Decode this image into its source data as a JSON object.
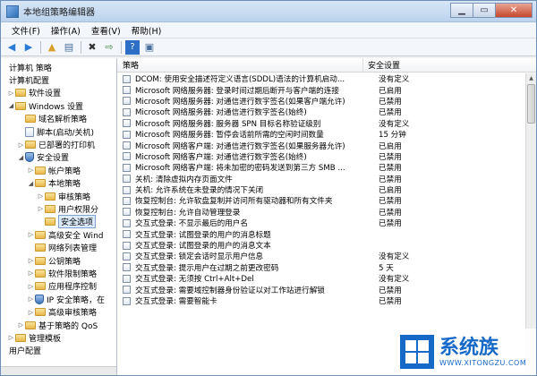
{
  "window": {
    "title": "本地组策略编辑器"
  },
  "menu": [
    "文件(F)",
    "操作(A)",
    "查看(V)",
    "帮助(H)"
  ],
  "tree": [
    {
      "indent": 0,
      "label": "计算机 策略",
      "icon": "none",
      "twisty": ""
    },
    {
      "indent": 0,
      "label": "计算机配置",
      "icon": "none",
      "twisty": ""
    },
    {
      "indent": 1,
      "label": "软件设置",
      "icon": "folder",
      "twisty": "▷"
    },
    {
      "indent": 1,
      "label": "Windows 设置",
      "icon": "folder",
      "twisty": "◢"
    },
    {
      "indent": 2,
      "label": "域名解析策略",
      "icon": "folder",
      "twisty": ""
    },
    {
      "indent": 2,
      "label": "脚本(启动/关机)",
      "icon": "doc",
      "twisty": ""
    },
    {
      "indent": 2,
      "label": "已部署的打印机",
      "icon": "folder",
      "twisty": "▷"
    },
    {
      "indent": 2,
      "label": "安全设置",
      "icon": "shield",
      "twisty": "◢"
    },
    {
      "indent": 3,
      "label": "帐户策略",
      "icon": "folder",
      "twisty": "▷"
    },
    {
      "indent": 3,
      "label": "本地策略",
      "icon": "folder",
      "twisty": "◢"
    },
    {
      "indent": 4,
      "label": "审核策略",
      "icon": "folder",
      "twisty": "▷"
    },
    {
      "indent": 4,
      "label": "用户权限分",
      "icon": "folder",
      "twisty": "▷"
    },
    {
      "indent": 4,
      "label": "安全选项",
      "icon": "folder",
      "twisty": "",
      "selected": true
    },
    {
      "indent": 3,
      "label": "高级安全 Wind",
      "icon": "folder",
      "twisty": "▷"
    },
    {
      "indent": 3,
      "label": "网络列表管理",
      "icon": "folder",
      "twisty": ""
    },
    {
      "indent": 3,
      "label": "公钥策略",
      "icon": "folder",
      "twisty": "▷"
    },
    {
      "indent": 3,
      "label": "软件限制策略",
      "icon": "folder",
      "twisty": "▷"
    },
    {
      "indent": 3,
      "label": "应用程序控制",
      "icon": "folder",
      "twisty": "▷"
    },
    {
      "indent": 3,
      "label": "IP 安全策略，在",
      "icon": "shield",
      "twisty": "▷"
    },
    {
      "indent": 3,
      "label": "高级审核策略",
      "icon": "folder",
      "twisty": "▷"
    },
    {
      "indent": 2,
      "label": "基于策略的 QoS",
      "icon": "folder",
      "twisty": "▷"
    },
    {
      "indent": 1,
      "label": "管理模板",
      "icon": "folder",
      "twisty": "▷"
    },
    {
      "indent": 0,
      "label": "用户配置",
      "icon": "none",
      "twisty": ""
    }
  ],
  "table": {
    "col_policy": "策略",
    "col_setting": "安全设置",
    "rows": [
      {
        "name": "DCOM: 使用安全描述符定义语言(SDDL)语法的计算机启动...",
        "value": "没有定义"
      },
      {
        "name": "Microsoft 网络服务器: 登录时间过期后断开与客户端的连接",
        "value": "已启用"
      },
      {
        "name": "Microsoft 网络服务器: 对通信进行数字签名(如果客户端允许)",
        "value": "已禁用"
      },
      {
        "name": "Microsoft 网络服务器: 对通信进行数字签名(始终)",
        "value": "已禁用"
      },
      {
        "name": "Microsoft 网络服务器: 服务器 SPN 目标名称验证级别",
        "value": "没有定义"
      },
      {
        "name": "Microsoft 网络服务器: 暂停会话前所需的空闲时间数量",
        "value": "15 分钟"
      },
      {
        "name": "Microsoft 网络客户端: 对通信进行数字签名(如果服务器允许)",
        "value": "已启用"
      },
      {
        "name": "Microsoft 网络客户端: 对通信进行数字签名(始终)",
        "value": "已禁用"
      },
      {
        "name": "Microsoft 网络客户端: 将未加密的密码发送到第三方 SMB ...",
        "value": "已禁用"
      },
      {
        "name": "关机: 清除虚拟内存页面文件",
        "value": "已禁用"
      },
      {
        "name": "关机: 允许系统在未登录的情况下关闭",
        "value": "已启用"
      },
      {
        "name": "恢复控制台: 允许软盘复制并访问所有驱动器和所有文件夹",
        "value": "已禁用"
      },
      {
        "name": "恢复控制台: 允许自动管理登录",
        "value": "已禁用"
      },
      {
        "name": "交互式登录: 不显示最后的用户名",
        "value": "已禁用"
      },
      {
        "name": "交互式登录: 试图登录的用户的消息标题",
        "value": ""
      },
      {
        "name": "交互式登录: 试图登录的用户的消息文本",
        "value": ""
      },
      {
        "name": "交互式登录: 锁定会话时显示用户信息",
        "value": "没有定义"
      },
      {
        "name": "交互式登录: 提示用户在过期之前更改密码",
        "value": "5 天"
      },
      {
        "name": "交互式登录: 无须按 Ctrl+Alt+Del",
        "value": "没有定义"
      },
      {
        "name": "交互式登录: 需要域控制器身份验证以对工作站进行解锁",
        "value": "已禁用"
      },
      {
        "name": "交互式登录: 需要智能卡",
        "value": "已禁用"
      }
    ]
  },
  "watermark": {
    "title": "系统族",
    "url": "WWW.XITONGZU.COM"
  }
}
